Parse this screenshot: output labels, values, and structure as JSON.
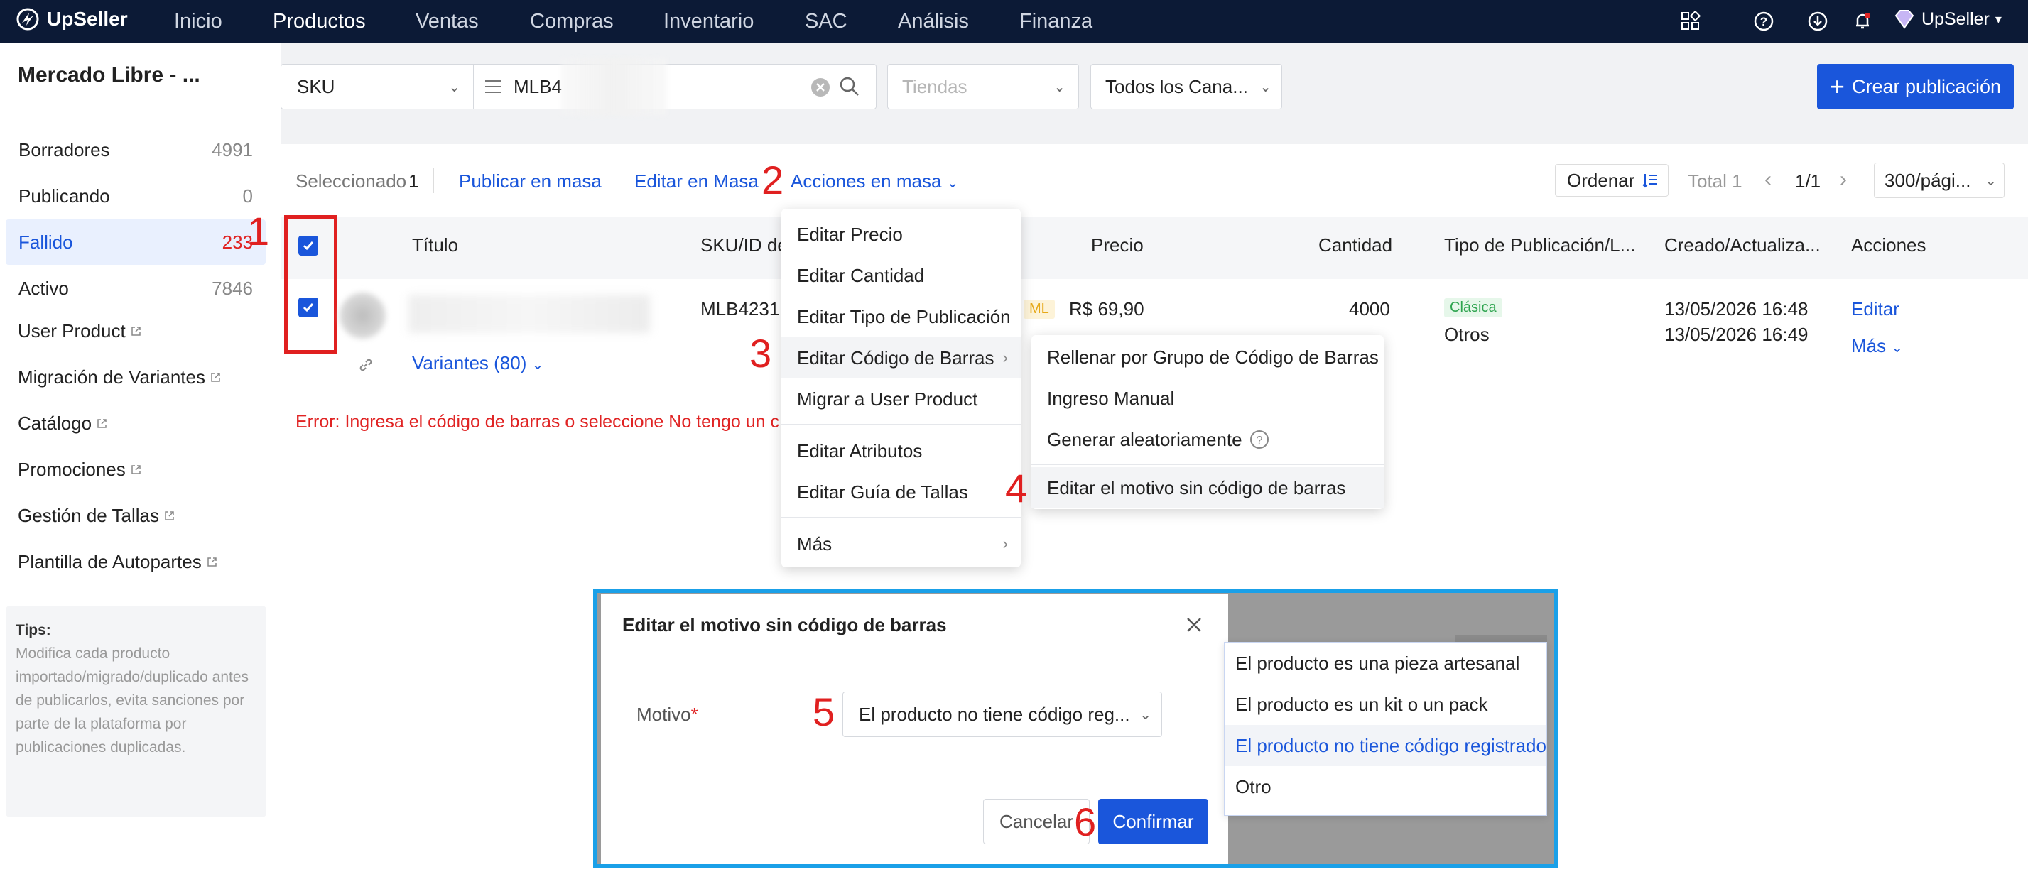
{
  "topnav": {
    "brand": "UpSeller",
    "items": [
      "Inicio",
      "Productos",
      "Ventas",
      "Compras",
      "Inventario",
      "SAC",
      "Análisis",
      "Finanza"
    ],
    "active": "Productos",
    "user": "UpSeller",
    "icons": [
      "apps-icon",
      "help-icon",
      "download-icon",
      "bell-icon",
      "diamond-icon"
    ]
  },
  "sidebar": {
    "store": "Mercado Libre - ...",
    "items": [
      {
        "label": "Borradores",
        "count": "4991"
      },
      {
        "label": "Publicando",
        "count": "0"
      },
      {
        "label": "Fallido",
        "count": "233"
      },
      {
        "label": "Activo",
        "count": "7846"
      }
    ],
    "links": [
      "User Product",
      "Migración de Variantes",
      "Catálogo",
      "Promociones",
      "Gestión de Tallas",
      "Plantilla de Autopartes"
    ],
    "tips_title": "Tips:",
    "tips_text": "Modifica cada producto importado/migrado/duplicado antes de publicarlos, evita sanciones por parte de la plataforma por publicaciones duplicadas."
  },
  "filters": {
    "search_type": "SKU",
    "search_value": "MLB4",
    "stores_placeholder": "Tiendas",
    "channels": "Todos los Cana...",
    "create_button": "Crear publicación"
  },
  "toolbar": {
    "selected_label": "Seleccionado",
    "selected_count": "1",
    "publish_mass": "Publicar en masa",
    "edit_mass": "Editar en Masa",
    "actions_mass": "Acciones en masa",
    "sort": "Ordenar",
    "total": "Total 1",
    "page": "1/1",
    "per_page": "300/pági..."
  },
  "table": {
    "headers": [
      "Título",
      "SKU/ID de",
      "Precio",
      "Cantidad",
      "Tipo de Publicación/L...",
      "Creado/Actualiza...",
      "Acciones"
    ],
    "row": {
      "sku": "MLB4231",
      "badge": "ML",
      "price": "R$ 69,90",
      "quantity": "4000",
      "type_badge": "Clásica",
      "type_other": "Otros",
      "created": "13/05/2026 16:48",
      "updated": "13/05/2026 16:49",
      "edit": "Editar",
      "more": "Más",
      "variants": "Variantes (80)"
    },
    "error": "Error: Ingresa el código de barras o seleccione No tengo un c"
  },
  "actions_menu": {
    "items": [
      "Editar Precio",
      "Editar Cantidad",
      "Editar Tipo de Publicación",
      "Editar Código de Barras",
      "Migrar a User Product",
      "Editar Atributos",
      "Editar Guía de Tallas",
      "Más"
    ]
  },
  "barcode_submenu": {
    "items": [
      "Rellenar por Grupo de Código de Barras",
      "Ingreso Manual",
      "Generar aleatoriamente",
      "Editar el motivo sin código de barras"
    ]
  },
  "modal": {
    "title": "Editar el motivo sin código de barras",
    "field_label": "Motivo",
    "required": "*",
    "selected": "El producto no tiene código reg...",
    "cancel": "Cancelar",
    "confirm": "Confirmar",
    "options": [
      "El producto es una pieza artesanal",
      "El producto es un kit o un pack",
      "El producto no tiene código registrado",
      "Otro"
    ]
  },
  "annotations": [
    "1",
    "2",
    "3",
    "4",
    "5",
    "6"
  ],
  "colors": {
    "nav_bg": "#0c1a36",
    "primary": "#1a56db",
    "error": "#e02424",
    "annotation": "#e02020",
    "highlight_border": "#1aa0e8"
  }
}
